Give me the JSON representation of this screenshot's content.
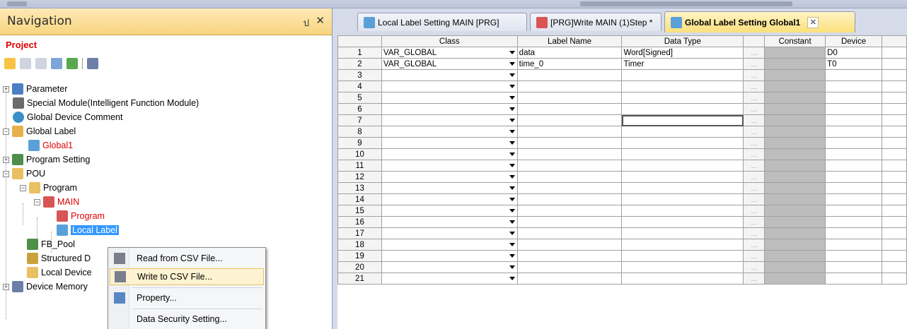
{
  "nav": {
    "title": "Navigation",
    "pin_glyph": "ป",
    "close_glyph": "✕",
    "project_label": "Project",
    "tree": [
      {
        "label": "Parameter"
      },
      {
        "label": "Special Module(Intelligent Function Module)"
      },
      {
        "label": "Global Device Comment"
      },
      {
        "label": "Global Label"
      },
      {
        "label": "Global1"
      },
      {
        "label": "Program Setting"
      },
      {
        "label": "POU"
      },
      {
        "label": "Program"
      },
      {
        "label": "MAIN"
      },
      {
        "label": "Program"
      },
      {
        "label": "Local Label"
      },
      {
        "label": "FB_Pool"
      },
      {
        "label": "Structured D"
      },
      {
        "label": "Local Device"
      },
      {
        "label": "Device Memory"
      }
    ]
  },
  "context_menu": {
    "items": [
      {
        "label": "Read from CSV File..."
      },
      {
        "label": "Write to CSV File..."
      },
      {
        "label": "Property..."
      },
      {
        "label": "Data Security Setting..."
      }
    ]
  },
  "tabs": [
    {
      "label": "Local Label Setting MAIN [PRG]"
    },
    {
      "label": "[PRG]Write MAIN (1)Step *"
    },
    {
      "label": "Global Label Setting Global1"
    }
  ],
  "grid": {
    "headers": {
      "class": "Class",
      "label_name": "Label Name",
      "data_type": "Data Type",
      "constant": "Constant",
      "device": "Device"
    },
    "rows": [
      {
        "num": "1",
        "class": "VAR_GLOBAL",
        "label": "data",
        "type": "Word[Signed]",
        "device": "D0"
      },
      {
        "num": "2",
        "class": "VAR_GLOBAL",
        "label": "time_0",
        "type": "Timer",
        "device": "T0"
      },
      {
        "num": "3",
        "class": "",
        "label": "",
        "type": "",
        "device": ""
      },
      {
        "num": "4",
        "class": "",
        "label": "",
        "type": "",
        "device": ""
      },
      {
        "num": "5",
        "class": "",
        "label": "",
        "type": "",
        "device": ""
      },
      {
        "num": "6",
        "class": "",
        "label": "",
        "type": "",
        "device": ""
      },
      {
        "num": "7",
        "class": "",
        "label": "",
        "type": "",
        "device": ""
      },
      {
        "num": "8",
        "class": "",
        "label": "",
        "type": "",
        "device": ""
      },
      {
        "num": "9",
        "class": "",
        "label": "",
        "type": "",
        "device": ""
      },
      {
        "num": "10",
        "class": "",
        "label": "",
        "type": "",
        "device": ""
      },
      {
        "num": "11",
        "class": "",
        "label": "",
        "type": "",
        "device": ""
      },
      {
        "num": "12",
        "class": "",
        "label": "",
        "type": "",
        "device": ""
      },
      {
        "num": "13",
        "class": "",
        "label": "",
        "type": "",
        "device": ""
      },
      {
        "num": "14",
        "class": "",
        "label": "",
        "type": "",
        "device": ""
      },
      {
        "num": "15",
        "class": "",
        "label": "",
        "type": "",
        "device": ""
      },
      {
        "num": "16",
        "class": "",
        "label": "",
        "type": "",
        "device": ""
      },
      {
        "num": "17",
        "class": "",
        "label": "",
        "type": "",
        "device": ""
      },
      {
        "num": "18",
        "class": "",
        "label": "",
        "type": "",
        "device": ""
      },
      {
        "num": "19",
        "class": "",
        "label": "",
        "type": "",
        "device": ""
      },
      {
        "num": "20",
        "class": "",
        "label": "",
        "type": "",
        "device": ""
      },
      {
        "num": "21",
        "class": "",
        "label": "",
        "type": "",
        "device": ""
      }
    ]
  }
}
